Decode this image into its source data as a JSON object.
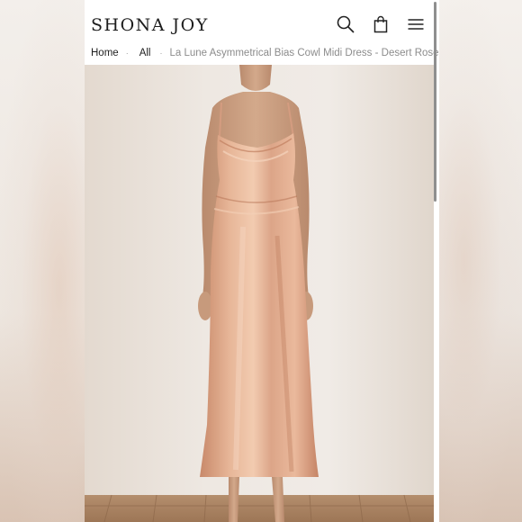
{
  "header": {
    "logo": "SHONA JOY",
    "icons": [
      "search-icon",
      "shopping-bag-icon",
      "menu-icon"
    ]
  },
  "breadcrumb": {
    "home": "Home",
    "separator": "·",
    "all": "All",
    "current": "La Lune Asymmetrical Bias Cowl Midi Dress - Desert Rose"
  },
  "product_image": {
    "subject": "model-wearing-satin-dress",
    "dress_color": "#d9a588"
  }
}
